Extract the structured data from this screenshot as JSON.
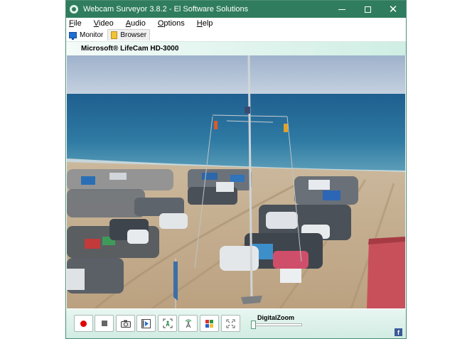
{
  "window": {
    "title": "Webcam Surveyor 3.8.2 - El Software Solutions",
    "minimize_glyph": "",
    "close_glyph": "✕"
  },
  "menu": [
    {
      "label_first": "F",
      "label_rest": "ile"
    },
    {
      "label_first": "V",
      "label_rest": "ideo"
    },
    {
      "label_first": "A",
      "label_rest": "udio"
    },
    {
      "label_first": "O",
      "label_rest": "ptions"
    },
    {
      "label_first": "H",
      "label_rest": "elp"
    }
  ],
  "tabs": {
    "monitor": "Monitor",
    "browser": "Browser"
  },
  "camera": {
    "name": "Microsoft® LifeCam HD-3000"
  },
  "controls": {
    "zoom_label": "DigitalZoom",
    "zoom_value": 0,
    "facebook_glyph": "f",
    "buttons": [
      "record",
      "stop",
      "snapshot",
      "video-capture",
      "motion-detection",
      "broadcast",
      "color-settings",
      "fullscreen"
    ]
  },
  "colors": {
    "titlebar": "#2f7d5e",
    "record": "#e00000",
    "facebook": "#3b5998"
  }
}
